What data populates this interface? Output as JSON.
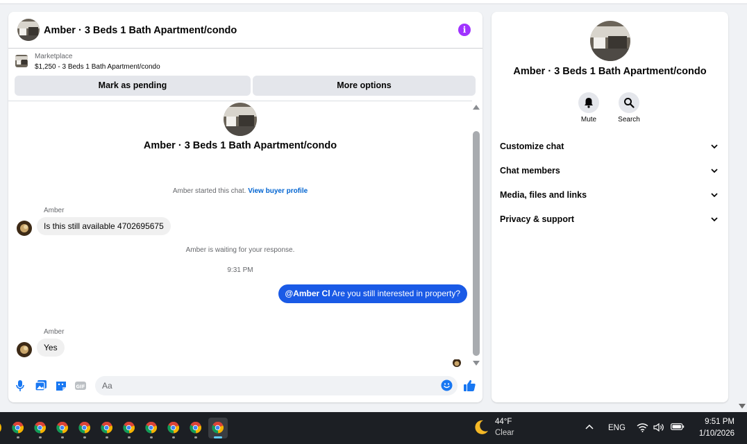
{
  "colors": {
    "accent_blue": "#1a5ae6",
    "info_purple": "#a033ff",
    "link_blue": "#0064d1",
    "taskbar": "#1c1f24"
  },
  "chat": {
    "header_title": "Amber · 3 Beds 1 Bath Apartment/condo",
    "marketplace_label": "Marketplace",
    "listing_summary": "$1,250 - 3 Beds 1 Bath Apartment/condo",
    "mark_pending_label": "Mark as pending",
    "more_options_label": "More options",
    "center_title": "Amber · 3 Beds 1 Bath Apartment/condo",
    "started_text": "Amber started this chat.",
    "view_profile_link": "View buyer profile",
    "messages": [
      {
        "sender": "Amber",
        "text": "Is this still available 4702695675"
      },
      {
        "mention": "@Amber Cl",
        "text": "Are you still interested in property?"
      },
      {
        "sender": "Amber",
        "text": "Yes"
      }
    ],
    "waiting_text": "Amber is waiting for your response.",
    "timestamp": "9:31 PM",
    "composer_placeholder": "Aa",
    "icons": [
      "microphone-icon",
      "photo-icon",
      "sticker-icon",
      "gif-icon",
      "emoji-icon",
      "thumbs-up-icon",
      "info-icon"
    ]
  },
  "info_panel": {
    "title": "Amber · 3 Beds 1 Bath Apartment/condo",
    "mute_label": "Mute",
    "search_label": "Search",
    "sections": [
      "Customize chat",
      "Chat members",
      "Media, files and links",
      "Privacy & support"
    ]
  },
  "taskbar": {
    "app_count": 10,
    "weather_temp": "44°F",
    "weather_desc": "Clear",
    "language": "ENG",
    "time": "9:51 PM",
    "date": "1/10/2026"
  }
}
